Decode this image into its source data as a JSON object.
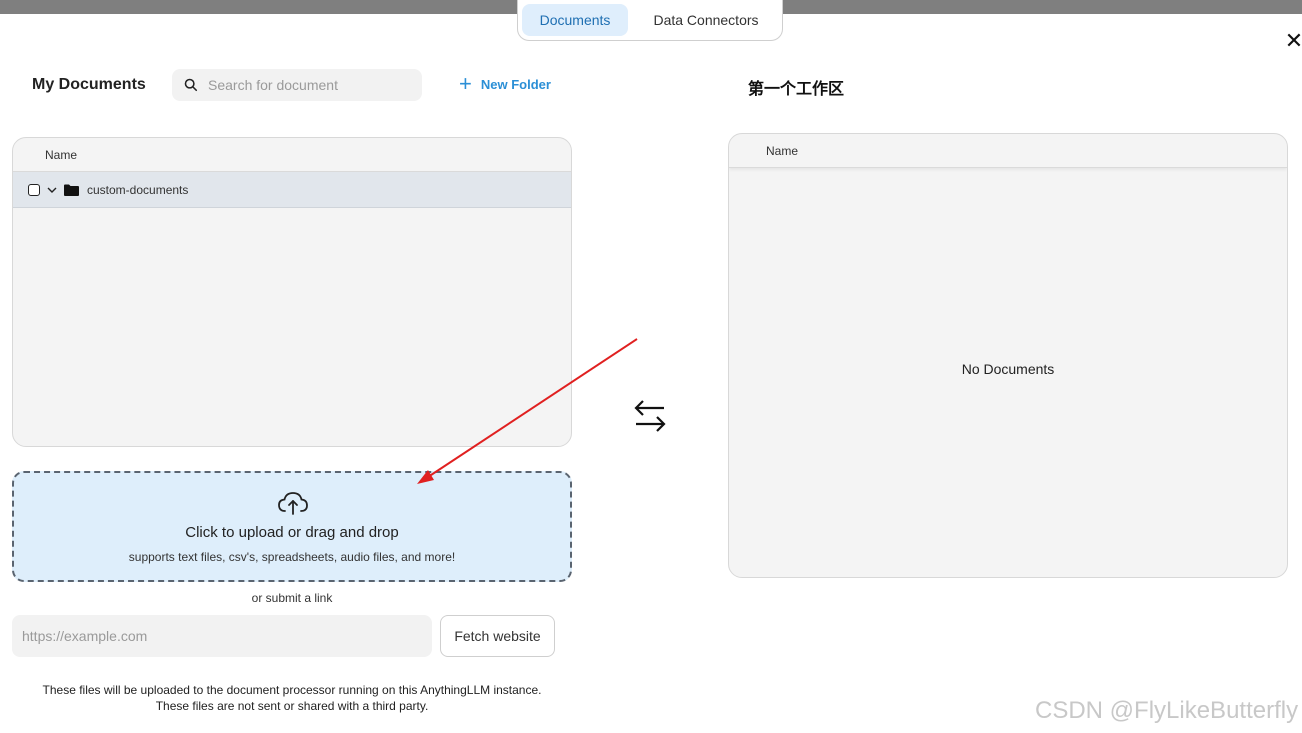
{
  "tabs": [
    {
      "label": "Documents",
      "active": true
    },
    {
      "label": "Data Connectors",
      "active": false
    }
  ],
  "close_icon": "close-icon",
  "my_documents": {
    "title": "My Documents",
    "search": {
      "placeholder": "Search for document",
      "value": ""
    },
    "new_folder_label": "New Folder",
    "table": {
      "header": "Name",
      "rows": [
        {
          "name": "custom-documents",
          "type": "folder",
          "checked": false,
          "expanded": false
        }
      ]
    }
  },
  "workspace": {
    "title": "第一个工作区",
    "table": {
      "header": "Name"
    },
    "empty_text": "No Documents"
  },
  "upload": {
    "title": "Click to upload or drag and drop",
    "subtitle": "supports text files, csv's, spreadsheets, audio files, and more!",
    "or_link_text": "or submit a link",
    "url_placeholder": "https://example.com",
    "fetch_label": "Fetch website",
    "footnote_line1": "These files will be uploaded to the document processor running on this AnythingLLM instance.",
    "footnote_line2": "These files are not sent or shared with a third party."
  },
  "watermark": "CSDN @FlyLikeButterfly",
  "colors": {
    "accent": "#2b8fd6",
    "tab_active_bg": "#dfeefc",
    "dropzone_bg": "#deeefb",
    "annotation_arrow": "#e02020"
  }
}
